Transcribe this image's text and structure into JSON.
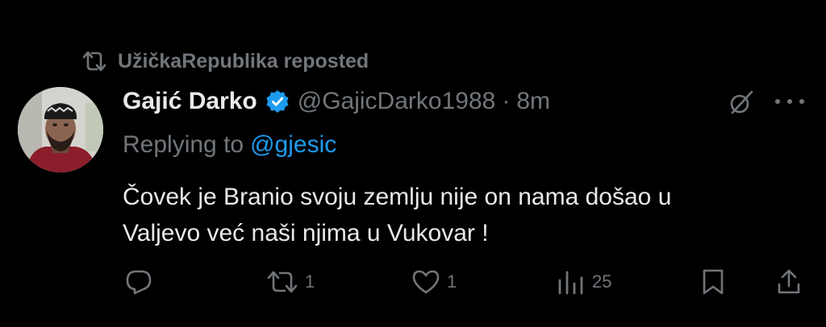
{
  "repost": {
    "text": "UžičkaRepublika reposted"
  },
  "tweet": {
    "display_name": "Gajić Darko",
    "handle": "@GajicDarko1988",
    "separator": "·",
    "time": "8m",
    "replying_prefix": "Replying to",
    "replying_to": "@gjesic",
    "text": "Čovek je Branio svoju zemlju nije on nama došao u\nValjevo već naši njima u Vukovar !"
  },
  "actions": {
    "reply_count": "",
    "retweet_count": "1",
    "like_count": "1",
    "views_count": "25"
  },
  "colors": {
    "background": "#000000",
    "text_primary": "#e7e9ea",
    "text_secondary": "#71767b",
    "accent": "#1d9bf0"
  },
  "icons": {
    "repost": "retweet-icon",
    "verified": "verified-badge-icon",
    "grok": "grok-icon",
    "more": "more-dots-icon",
    "reply": "reply-icon",
    "retweet": "retweet-icon",
    "like": "heart-icon",
    "views": "views-chart-icon",
    "bookmark": "bookmark-icon",
    "share": "share-icon"
  }
}
